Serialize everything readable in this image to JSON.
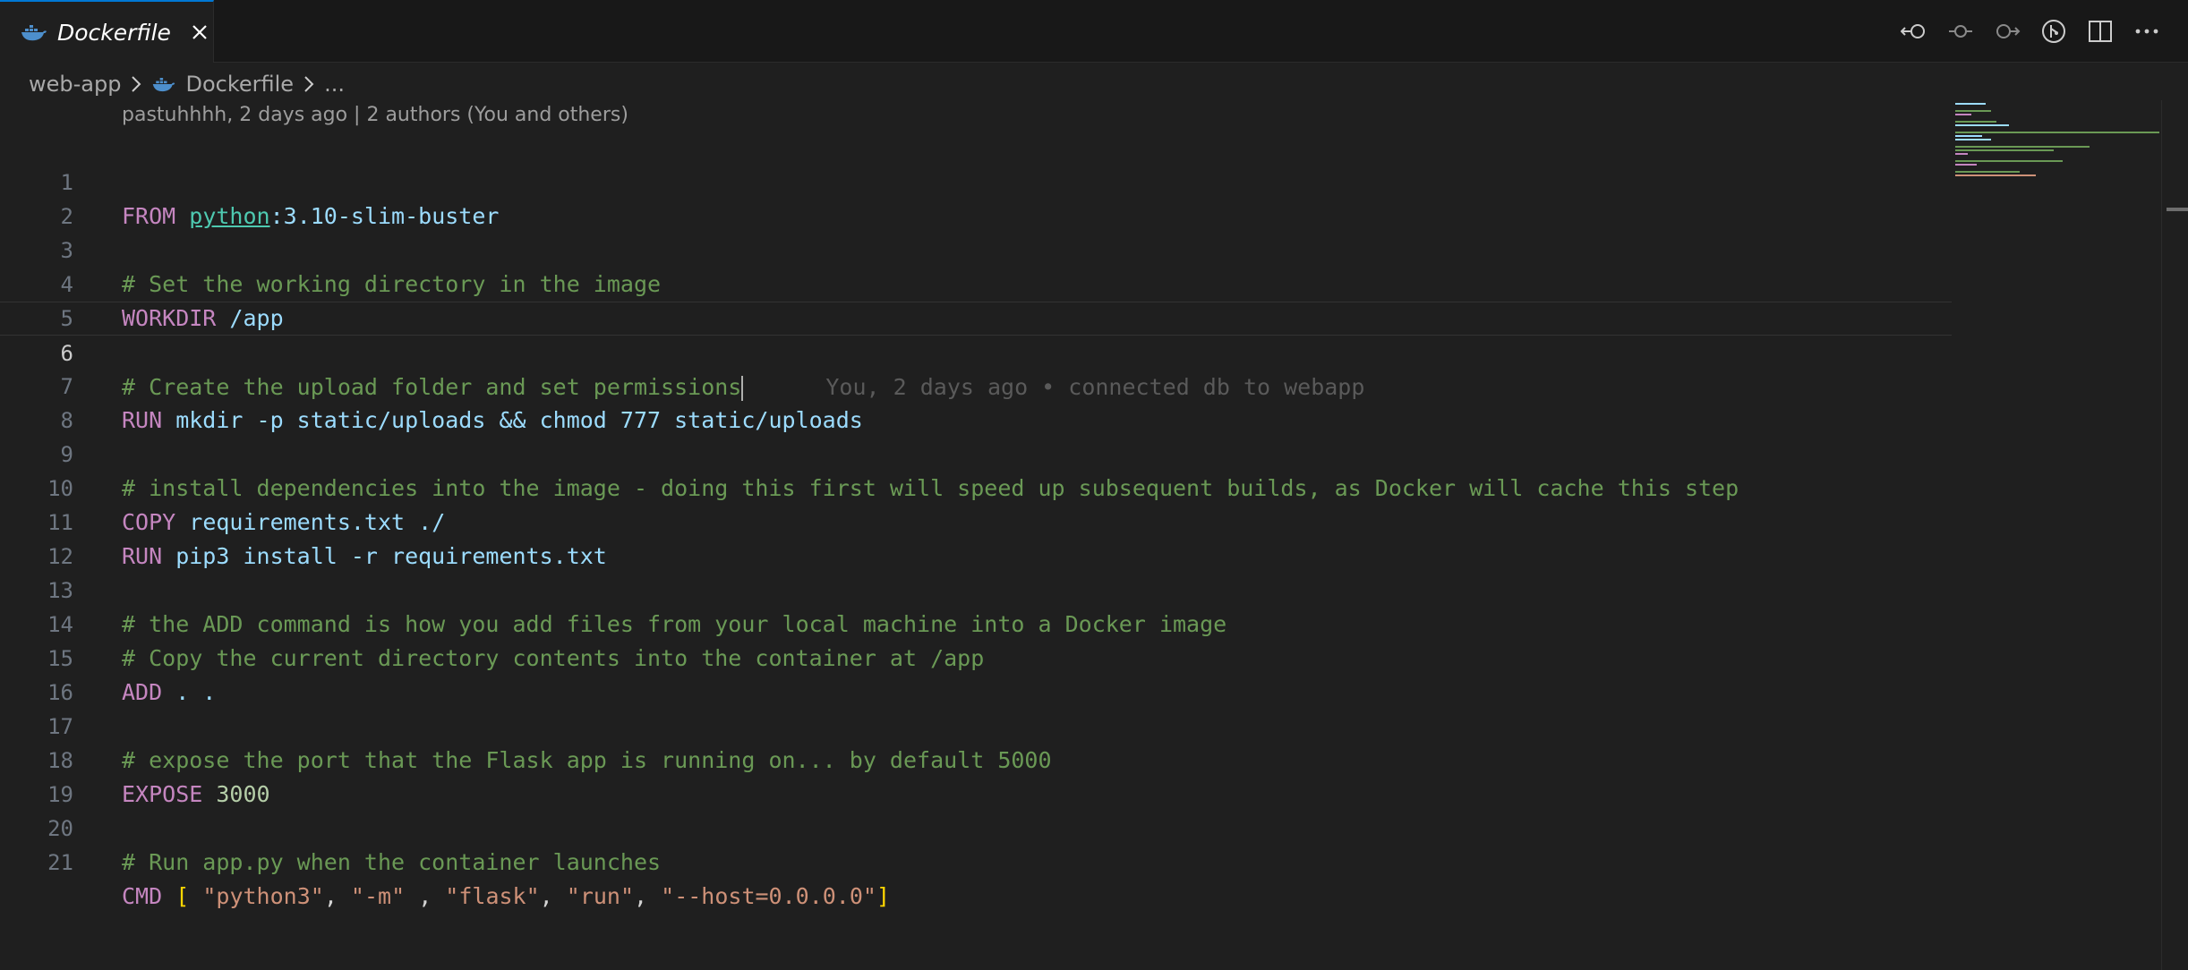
{
  "tab": {
    "label": "Dockerfile",
    "icon": "docker-icon"
  },
  "breadcrumb": {
    "folder": "web-app",
    "file": "Dockerfile",
    "more": "..."
  },
  "blame_header": "pastuhhhh, 2 days ago | 2 authors (You and others)",
  "inline_blame": "You, 2 days ago • connected db to webapp",
  "current_line": 6,
  "lines": [
    {
      "n": "1"
    },
    {
      "n": "2"
    },
    {
      "n": "3"
    },
    {
      "n": "4"
    },
    {
      "n": "5"
    },
    {
      "n": "6"
    },
    {
      "n": "7"
    },
    {
      "n": "8"
    },
    {
      "n": "9"
    },
    {
      "n": "10"
    },
    {
      "n": "11"
    },
    {
      "n": "12"
    },
    {
      "n": "13"
    },
    {
      "n": "14"
    },
    {
      "n": "15"
    },
    {
      "n": "16"
    },
    {
      "n": "17"
    },
    {
      "n": "18"
    },
    {
      "n": "19"
    },
    {
      "n": "20"
    },
    {
      "n": "21"
    }
  ],
  "code": {
    "l1_kw": "FROM",
    "l1_link": "python",
    "l1_rest": ":3.10-slim-buster",
    "l3": "# Set the working directory in the image",
    "l4_kw": "WORKDIR",
    "l4_rest": " /app",
    "l6": "# Create the upload folder and set permissions",
    "l7_kw": "RUN",
    "l7_rest": " mkdir -p static/uploads && chmod 777 static/uploads",
    "l9": "# install dependencies into the image - doing this first will speed up subsequent builds, as Docker will cache this step",
    "l10_kw": "COPY",
    "l10_rest": " requirements.txt ./",
    "l11_kw": "RUN",
    "l11_rest": " pip3 install -r requirements.txt",
    "l13": "# the ADD command is how you add files from your local machine into a Docker image",
    "l14": "# Copy the current directory contents into the container at /app",
    "l15_kw": "ADD",
    "l15_rest": " . .",
    "l17": "# expose the port that the Flask app is running on... by default 5000",
    "l18_kw": "EXPOSE",
    "l18_num": "3000",
    "l20": "# Run app.py when the container launches",
    "l21_kw": "CMD",
    "l21_args": [
      "\"python3\"",
      "\"-m\"",
      "\"flask\"",
      "\"run\"",
      "\"--host=0.0.0.0\""
    ]
  },
  "actions": [
    "open-changes-icon",
    "previous-change-icon",
    "next-change-icon",
    "git-graph-icon",
    "split-editor-icon",
    "more-actions-icon"
  ],
  "colors": {
    "accent": "#0078d4",
    "keyword": "#c586c0",
    "comment": "#6a9955",
    "string": "#ce9178"
  }
}
